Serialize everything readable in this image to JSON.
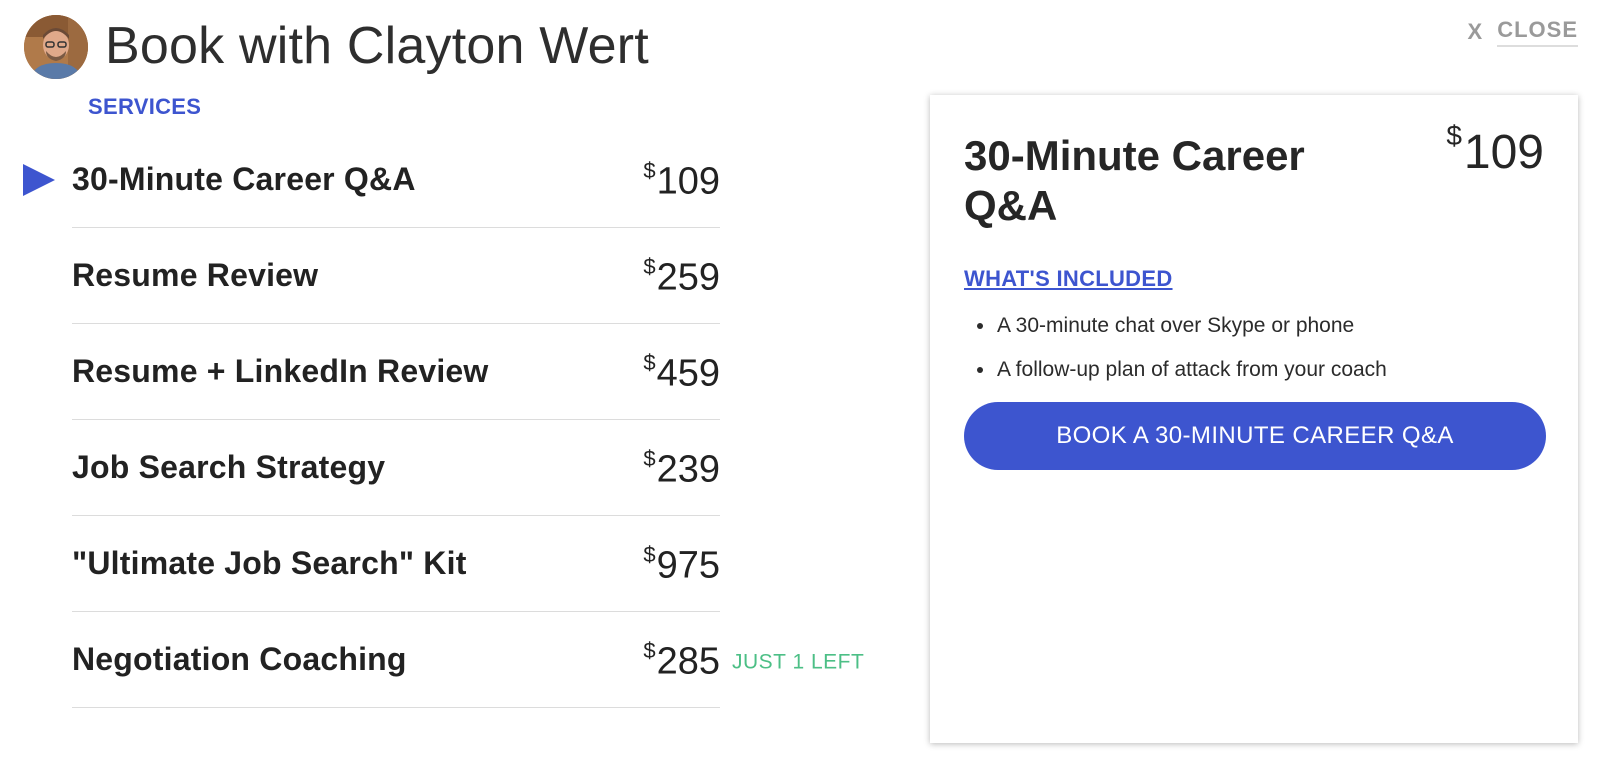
{
  "header": {
    "title": "Book with Clayton Wert",
    "close_icon": "X",
    "close_label": "CLOSE"
  },
  "section_label": "SERVICES",
  "services": [
    {
      "name": "30-Minute Career Q&A",
      "currency": "$",
      "price": "109",
      "selected": true,
      "badge": ""
    },
    {
      "name": "Resume Review",
      "currency": "$",
      "price": "259",
      "selected": false,
      "badge": ""
    },
    {
      "name": "Resume + LinkedIn Review",
      "currency": "$",
      "price": "459",
      "selected": false,
      "badge": ""
    },
    {
      "name": "Job Search Strategy",
      "currency": "$",
      "price": "239",
      "selected": false,
      "badge": ""
    },
    {
      "name": "\"Ultimate Job Search\" Kit",
      "currency": "$",
      "price": "975",
      "selected": false,
      "badge": ""
    },
    {
      "name": "Negotiation Coaching",
      "currency": "$",
      "price": "285",
      "selected": false,
      "badge": "JUST 1 LEFT"
    }
  ],
  "detail": {
    "title": "30-Minute Career Q&A",
    "currency": "$",
    "price": "109",
    "included_label": "WHAT'S INCLUDED",
    "included_items": [
      "A 30-minute chat over Skype or phone",
      "A follow-up plan of attack from your coach"
    ],
    "book_button_label": "BOOK A 30-MINUTE CAREER Q&A"
  },
  "colors": {
    "accent": "#3d55cf",
    "badge": "#4cbf86",
    "close": "#9a9a9a"
  }
}
